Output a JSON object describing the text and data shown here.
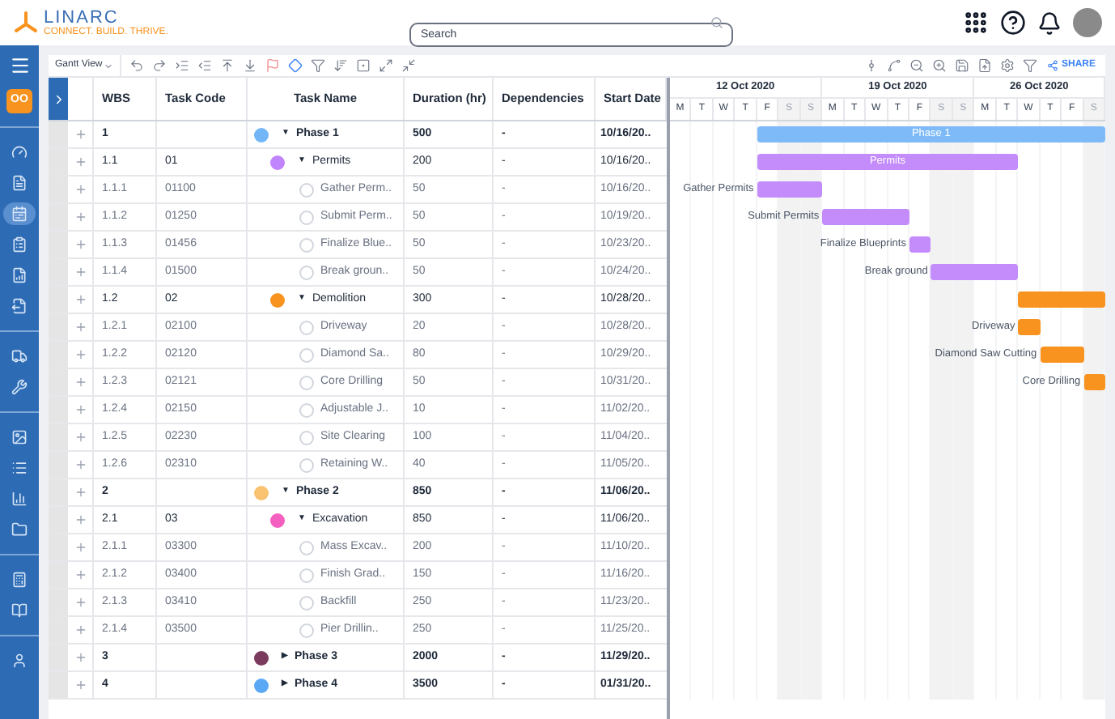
{
  "header": {
    "logo": "LINARC",
    "tagline": "CONNECT. BUILD. THRIVE.",
    "search": {
      "placeholder": "Search"
    }
  },
  "sidebar": {
    "badge": "OO",
    "groups": [
      [
        {
          "selected": false
        },
        {
          "selected": false
        },
        {
          "selected": true
        },
        {
          "selected": false
        },
        {
          "selected": false
        },
        {
          "selected": false
        }
      ],
      [
        {
          "selected": false
        },
        {
          "selected": false
        }
      ],
      [
        {
          "selected": false
        },
        {
          "selected": false
        },
        {
          "selected": false
        },
        {
          "selected": false
        }
      ],
      [
        {
          "selected": false
        },
        {
          "selected": false
        }
      ],
      [
        {
          "selected": false
        }
      ]
    ]
  },
  "toolbar": {
    "view": "Gantt View",
    "share": "SHARE"
  },
  "table": {
    "columns": [
      "WBS",
      "Task Code",
      "Task Name",
      "Duration (hr)",
      "Dependencies",
      "Start Date"
    ],
    "rows": [
      {
        "kind": "phase",
        "wbs": "1",
        "name": "Phase 1",
        "color": "#72b6f7",
        "caret": "▼",
        "duration": "500",
        "deps": "-",
        "start": "10/16/20..",
        "children": [
          {
            "kind": "group",
            "wbs": "1.1",
            "code": "01",
            "name": "Permits",
            "color": "#c084fc",
            "caret": "▼",
            "duration": "200",
            "deps": "-",
            "start": "10/16/20..",
            "children": [
              {
                "kind": "task",
                "wbs": "1.1.1",
                "code": "01100",
                "name": "Gather Perm..",
                "duration": "50",
                "deps": "-",
                "start": "10/16/20.."
              },
              {
                "kind": "task",
                "wbs": "1.1.2",
                "code": "01250",
                "name": "Submit Perm..",
                "duration": "50",
                "deps": "-",
                "start": "10/19/20.."
              },
              {
                "kind": "task",
                "wbs": "1.1.3",
                "code": "01456",
                "name": "Finalize Blue..",
                "duration": "50",
                "deps": "-",
                "start": "10/23/20.."
              },
              {
                "kind": "task",
                "wbs": "1.1.4",
                "code": "01500",
                "name": "Break groun..",
                "duration": "50",
                "deps": "-",
                "start": "10/24/20.."
              }
            ]
          },
          {
            "kind": "group",
            "wbs": "1.2",
            "code": "02",
            "name": "Demolition",
            "color": "#f7931e",
            "caret": "▼",
            "duration": "300",
            "deps": "-",
            "start": "10/28/20..",
            "children": [
              {
                "kind": "task",
                "wbs": "1.2.1",
                "code": "02100",
                "name": "Driveway",
                "duration": "20",
                "deps": "-",
                "start": "10/28/20.."
              },
              {
                "kind": "task",
                "wbs": "1.2.2",
                "code": "02120",
                "name": "Diamond Sa..",
                "duration": "80",
                "deps": "-",
                "start": "10/29/20.."
              },
              {
                "kind": "task",
                "wbs": "1.2.3",
                "code": "02121",
                "name": "Core Drilling",
                "duration": "50",
                "deps": "-",
                "start": "10/31/20.."
              },
              {
                "kind": "task",
                "wbs": "1.2.4",
                "code": "02150",
                "name": "Adjustable J..",
                "duration": "10",
                "deps": "-",
                "start": "11/02/20.."
              },
              {
                "kind": "task",
                "wbs": "1.2.5",
                "code": "02230",
                "name": "Site Clearing",
                "duration": "100",
                "deps": "-",
                "start": "11/04/20.."
              },
              {
                "kind": "task",
                "wbs": "1.2.6",
                "code": "02310",
                "name": "Retaining W..",
                "duration": "40",
                "deps": "-",
                "start": "11/05/20.."
              }
            ]
          }
        ]
      },
      {
        "kind": "phase",
        "wbs": "2",
        "name": "Phase 2",
        "color": "#f9c270",
        "caret": "▼",
        "duration": "850",
        "deps": "-",
        "start": "11/06/20..",
        "children": [
          {
            "kind": "group",
            "wbs": "2.1",
            "code": "03",
            "name": "Excavation",
            "color": "#f55fc0",
            "caret": "▼",
            "duration": "850",
            "deps": "-",
            "start": "11/06/20..",
            "children": [
              {
                "kind": "task",
                "wbs": "2.1.1",
                "code": "03300",
                "name": "Mass Excav..",
                "duration": "200",
                "deps": "-",
                "start": "11/10/20.."
              },
              {
                "kind": "task",
                "wbs": "2.1.2",
                "code": "03400",
                "name": "Finish Grad..",
                "duration": "150",
                "deps": "-",
                "start": "11/16/20.."
              },
              {
                "kind": "task",
                "wbs": "2.1.3",
                "code": "03410",
                "name": "Backfill",
                "duration": "250",
                "deps": "-",
                "start": "11/23/20.."
              },
              {
                "kind": "task",
                "wbs": "2.1.4",
                "code": "03500",
                "name": "Pier Drillin..",
                "duration": "250",
                "deps": "-",
                "start": "11/25/20.."
              }
            ]
          }
        ]
      },
      {
        "kind": "phase",
        "wbs": "3",
        "name": "Phase 3",
        "color": "#7a3b5e",
        "caret": "▶",
        "duration": "2000",
        "deps": "-",
        "start": "11/29/20.."
      },
      {
        "kind": "phase",
        "wbs": "4",
        "name": "Phase 4",
        "color": "#5aa8f5",
        "caret": "▶",
        "duration": "3500",
        "deps": "-",
        "start": "01/31/20.."
      }
    ]
  },
  "gantt": {
    "weeks": [
      "12 Oct 2020",
      "19 Oct 2020",
      "26 Oct 2020"
    ],
    "days": [
      {
        "label": "M",
        "weekend": false
      },
      {
        "label": "T",
        "weekend": false
      },
      {
        "label": "W",
        "weekend": false
      },
      {
        "label": "T",
        "weekend": false
      },
      {
        "label": "F",
        "weekend": false
      },
      {
        "label": "S",
        "weekend": true
      },
      {
        "label": "S",
        "weekend": true
      },
      {
        "label": "M",
        "weekend": false
      },
      {
        "label": "T",
        "weekend": false
      },
      {
        "label": "W",
        "weekend": false
      },
      {
        "label": "T",
        "weekend": false
      },
      {
        "label": "F",
        "weekend": false
      },
      {
        "label": "S",
        "weekend": true
      },
      {
        "label": "S",
        "weekend": true
      },
      {
        "label": "M",
        "weekend": false
      },
      {
        "label": "T",
        "weekend": false
      },
      {
        "label": "W",
        "weekend": false
      },
      {
        "label": "T",
        "weekend": false
      },
      {
        "label": "F",
        "weekend": false
      },
      {
        "label": "S",
        "weekend": true
      }
    ],
    "bars": [
      {
        "kind": "summary",
        "label": "Phase 1",
        "color": "#7dbaf7"
      },
      {
        "kind": "summary",
        "label": "Permits",
        "color": "#c48cfa"
      },
      {
        "kind": "task",
        "label": "Gather Permits",
        "color": "#c48cfa"
      },
      {
        "kind": "task",
        "label": "Submit Permits",
        "color": "#c48cfa"
      },
      {
        "kind": "task",
        "label": "Finalize Blueprints",
        "color": "#c48cfa"
      },
      {
        "kind": "task",
        "label": "Break ground",
        "color": "#c48cfa"
      },
      {
        "kind": "summary",
        "color": "#f7931e"
      },
      {
        "kind": "task",
        "label": "Driveway",
        "color": "#f7931e"
      },
      {
        "kind": "task",
        "label": "Diamond Saw Cutting",
        "color": "#f7931e"
      },
      {
        "kind": "task",
        "label": "Core Drilling",
        "color": "#f7931e"
      }
    ]
  }
}
